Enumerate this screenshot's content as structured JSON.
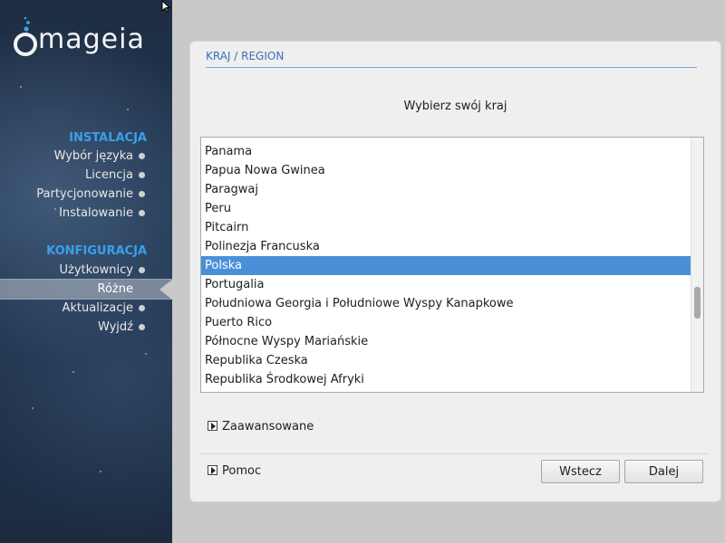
{
  "sidebar": {
    "logo_text": "mageia",
    "sections": [
      {
        "title": "INSTALACJA",
        "items": [
          {
            "label": "Wybór języka"
          },
          {
            "label": "Licencja"
          },
          {
            "label": "Partycjonowanie"
          },
          {
            "label": "Instalowanie"
          }
        ]
      },
      {
        "title": "KONFIGURACJA",
        "items": [
          {
            "label": "Użytkownicy"
          },
          {
            "label": "Różne",
            "current": true
          },
          {
            "label": "Aktualizacje"
          },
          {
            "label": "Wyjdź"
          }
        ]
      }
    ]
  },
  "panel": {
    "title": "KRAJ / REGION",
    "prompt": "Wybierz swój kraj",
    "countries": [
      "Panama",
      "Papua Nowa Gwinea",
      "Paragwaj",
      "Peru",
      "Pitcairn",
      "Polinezja Francuska",
      "Polska",
      "Portugalia",
      "Południowa Georgia i Południowe Wyspy Kanapkowe",
      "Puerto Rico",
      "Północne Wyspy Mariańskie",
      "Republika Czeska",
      "Republika Środkowej Afryki"
    ],
    "selected_country": "Polska",
    "advanced_label": "Zaawansowane",
    "help_label": "Pomoc",
    "back_label": "Wstecz",
    "next_label": "Dalej"
  },
  "colors": {
    "accent": "#3aa0ea",
    "selection": "#4a90d9",
    "title": "#3a6fb8"
  }
}
